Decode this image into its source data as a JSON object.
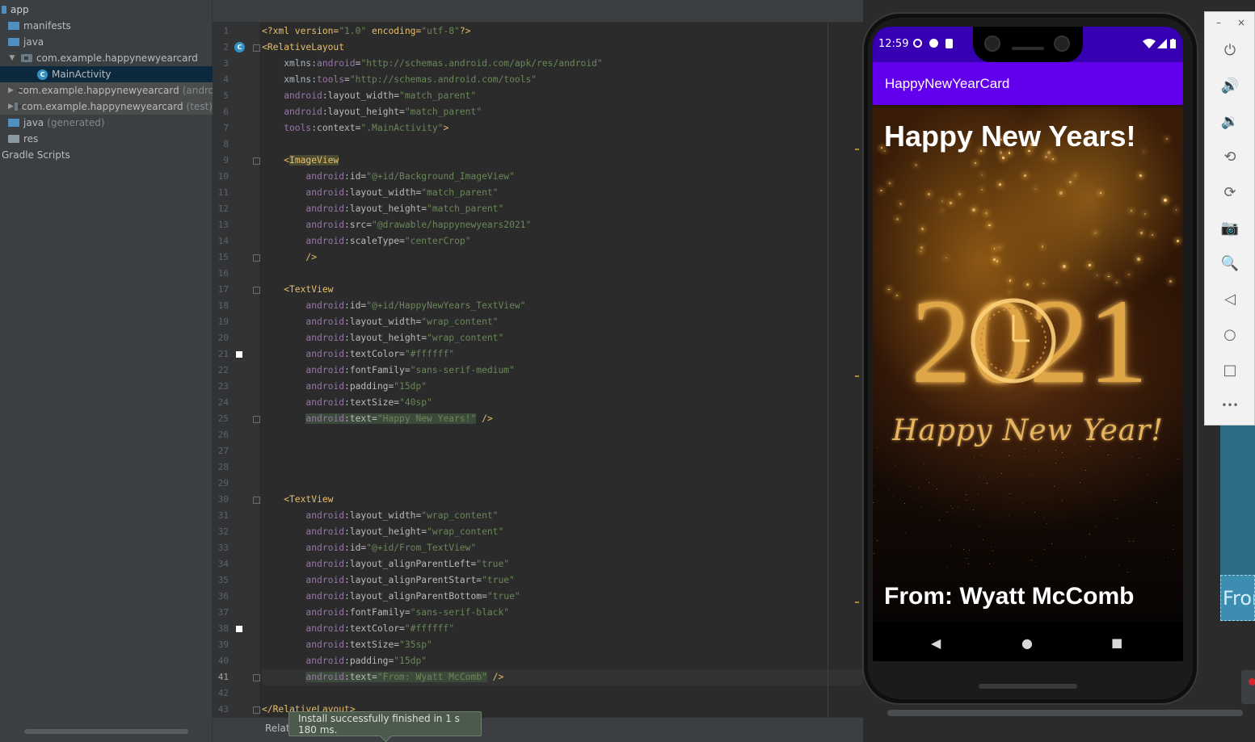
{
  "project_tree": {
    "items": [
      {
        "label": "app",
        "indent": 0,
        "kind": "module",
        "bold": true
      },
      {
        "label": "manifests",
        "indent": 1,
        "kind": "folder"
      },
      {
        "label": "java",
        "indent": 1,
        "kind": "folder"
      },
      {
        "label": "com.example.happynewyearcard",
        "indent": 2,
        "kind": "package",
        "expanded": true
      },
      {
        "label": "MainActivity",
        "indent": 3,
        "kind": "class",
        "selected": true
      },
      {
        "label": "com.example.happynewyearcard",
        "suffix": "(androi",
        "indent": 2,
        "kind": "package"
      },
      {
        "label": "com.example.happynewyearcard",
        "suffix": "(test)",
        "indent": 2,
        "kind": "package"
      },
      {
        "label": "java",
        "suffix": "(generated)",
        "indent": 1,
        "kind": "folder"
      },
      {
        "label": "res",
        "indent": 1,
        "kind": "res"
      },
      {
        "label": "Gradle Scripts",
        "indent": 0,
        "kind": "gradle"
      }
    ]
  },
  "editor": {
    "current_line": 41,
    "lines": [
      [
        [
          "t-tag",
          "<?xml version="
        ],
        [
          "t-val",
          "\"1.0\""
        ],
        [
          "t-tag",
          " encoding="
        ],
        [
          "t-val",
          "\"utf-8\""
        ],
        [
          "t-tag",
          "?>"
        ]
      ],
      [
        [
          "t-tag",
          "<RelativeLayout"
        ]
      ],
      [
        [
          "",
          "    xmlns:"
        ],
        [
          "t-ns",
          "android"
        ],
        [
          "t-attr",
          "="
        ],
        [
          "t-val",
          "\"http://schemas.android.com/apk/res/android\""
        ]
      ],
      [
        [
          "",
          "    xmlns:"
        ],
        [
          "t-ns",
          "tools"
        ],
        [
          "t-attr",
          "="
        ],
        [
          "t-val",
          "\"http://schemas.android.com/tools\""
        ]
      ],
      [
        [
          "t-ns",
          "    android"
        ],
        [
          "t-attr",
          ":layout_width="
        ],
        [
          "t-val",
          "\"match_parent\""
        ]
      ],
      [
        [
          "t-ns",
          "    android"
        ],
        [
          "t-attr",
          ":layout_height="
        ],
        [
          "t-val",
          "\"match_parent\""
        ]
      ],
      [
        [
          "t-ns",
          "    tools"
        ],
        [
          "t-attr",
          ":context="
        ],
        [
          "t-val",
          "\".MainActivity\""
        ],
        [
          "t-tag",
          ">"
        ]
      ],
      [],
      [
        [
          "t-tag",
          "    <"
        ],
        [
          "t-tag t-hltag",
          "ImageView"
        ]
      ],
      [
        [
          "t-ns",
          "        android"
        ],
        [
          "t-attr",
          ":id="
        ],
        [
          "t-val",
          "\"@+id/Background_ImageView\""
        ]
      ],
      [
        [
          "t-ns",
          "        android"
        ],
        [
          "t-attr",
          ":layout_width="
        ],
        [
          "t-val",
          "\"match_parent\""
        ]
      ],
      [
        [
          "t-ns",
          "        android"
        ],
        [
          "t-attr",
          ":layout_height="
        ],
        [
          "t-val",
          "\"match_parent\""
        ]
      ],
      [
        [
          "t-ns",
          "        android"
        ],
        [
          "t-attr",
          ":src="
        ],
        [
          "t-val",
          "\"@drawable/happynewyears2021\""
        ]
      ],
      [
        [
          "t-ns",
          "        android"
        ],
        [
          "t-attr",
          ":scaleType="
        ],
        [
          "t-val",
          "\"centerCrop\""
        ]
      ],
      [
        [
          "t-tag",
          "        />"
        ]
      ],
      [],
      [
        [
          "t-tag",
          "    <TextView"
        ]
      ],
      [
        [
          "t-ns",
          "        android"
        ],
        [
          "t-attr",
          ":id="
        ],
        [
          "t-val",
          "\"@+id/HappyNewYears_TextView\""
        ]
      ],
      [
        [
          "t-ns",
          "        android"
        ],
        [
          "t-attr",
          ":layout_width="
        ],
        [
          "t-val",
          "\"wrap_content\""
        ]
      ],
      [
        [
          "t-ns",
          "        android"
        ],
        [
          "t-attr",
          ":layout_height="
        ],
        [
          "t-val",
          "\"wrap_content\""
        ]
      ],
      [
        [
          "t-ns",
          "        android"
        ],
        [
          "t-attr",
          ":textColor="
        ],
        [
          "t-val",
          "\"#ffffff\""
        ]
      ],
      [
        [
          "t-ns",
          "        android"
        ],
        [
          "t-attr",
          ":fontFamily="
        ],
        [
          "t-val",
          "\"sans-serif-medium\""
        ]
      ],
      [
        [
          "t-ns",
          "        android"
        ],
        [
          "t-attr",
          ":padding="
        ],
        [
          "t-val",
          "\"15dp\""
        ]
      ],
      [
        [
          "t-ns",
          "        android"
        ],
        [
          "t-attr",
          ":textSize="
        ],
        [
          "t-val",
          "\"40sp\""
        ]
      ],
      [
        [
          "",
          "        "
        ],
        [
          "t-ns t-hl",
          "android"
        ],
        [
          "t-attr t-hl",
          ":text="
        ],
        [
          "t-val t-hl",
          "\"Happy New Years!\""
        ],
        [
          "t-tag",
          " />"
        ]
      ],
      [],
      [],
      [],
      [],
      [
        [
          "t-tag",
          "    <TextView"
        ]
      ],
      [
        [
          "t-ns",
          "        android"
        ],
        [
          "t-attr",
          ":layout_width="
        ],
        [
          "t-val",
          "\"wrap_content\""
        ]
      ],
      [
        [
          "t-ns",
          "        android"
        ],
        [
          "t-attr",
          ":layout_height="
        ],
        [
          "t-val",
          "\"wrap_content\""
        ]
      ],
      [
        [
          "t-ns",
          "        android"
        ],
        [
          "t-attr",
          ":id="
        ],
        [
          "t-val",
          "\"@+id/From_TextView\""
        ]
      ],
      [
        [
          "t-ns",
          "        android"
        ],
        [
          "t-attr",
          ":layout_alignParentLeft="
        ],
        [
          "t-val",
          "\"true\""
        ]
      ],
      [
        [
          "t-ns",
          "        android"
        ],
        [
          "t-attr",
          ":layout_alignParentStart="
        ],
        [
          "t-val",
          "\"true\""
        ]
      ],
      [
        [
          "t-ns",
          "        android"
        ],
        [
          "t-attr",
          ":layout_alignParentBottom="
        ],
        [
          "t-val",
          "\"true\""
        ]
      ],
      [
        [
          "t-ns",
          "        android"
        ],
        [
          "t-attr",
          ":fontFamily="
        ],
        [
          "t-val",
          "\"sans-serif-black\""
        ]
      ],
      [
        [
          "t-ns",
          "        android"
        ],
        [
          "t-attr",
          ":textColor="
        ],
        [
          "t-val",
          "\"#ffffff\""
        ]
      ],
      [
        [
          "t-ns",
          "        android"
        ],
        [
          "t-attr",
          ":textSize="
        ],
        [
          "t-val",
          "\"35sp\""
        ]
      ],
      [
        [
          "t-ns",
          "        android"
        ],
        [
          "t-attr",
          ":padding="
        ],
        [
          "t-val",
          "\"15dp\""
        ]
      ],
      [
        [
          "",
          "        "
        ],
        [
          "t-ns t-hl",
          "android"
        ],
        [
          "t-attr t-hl",
          ":text="
        ],
        [
          "t-val t-hl",
          "\"From: Wyatt McComb\""
        ],
        [
          "t-tag",
          " />"
        ]
      ],
      [],
      [
        [
          "t-tag",
          "</RelativeLayout>"
        ]
      ]
    ],
    "bottom_tab_label": "Relati",
    "toast": "Install successfully finished in 1 s 180 ms."
  },
  "emulator": {
    "status_time": "12:59",
    "app_title": "HappyNewYearCard",
    "heading_text": "Happy New Years!",
    "year_text": "2021",
    "script_text": "Happy New Year!",
    "from_text": "From: Wyatt McComb",
    "nav": {
      "back": "◀",
      "home": "●",
      "recents": "■"
    },
    "toolbar": {
      "minimize": "–",
      "close": "×",
      "buttons": [
        {
          "name": "power-icon",
          "glyph": "⏻"
        },
        {
          "name": "volume-up-icon",
          "glyph": "🔊"
        },
        {
          "name": "volume-down-icon",
          "glyph": "🔉"
        },
        {
          "name": "rotate-left-icon",
          "glyph": "⟲"
        },
        {
          "name": "rotate-right-icon",
          "glyph": "⟳"
        },
        {
          "name": "camera-icon",
          "glyph": "📷"
        },
        {
          "name": "zoom-icon",
          "glyph": "🔍"
        },
        {
          "name": "back-icon",
          "glyph": "◁"
        },
        {
          "name": "home-icon",
          "glyph": "○"
        },
        {
          "name": "overview-icon",
          "glyph": "□"
        },
        {
          "name": "more-icon",
          "glyph": "•••"
        }
      ]
    }
  },
  "preview_fragment_text": "From",
  "colors": {
    "status_bar": "#3700b3",
    "app_bar": "#6200ee",
    "editor_bg": "#2b2b2b",
    "panel_bg": "#3c3f41"
  }
}
